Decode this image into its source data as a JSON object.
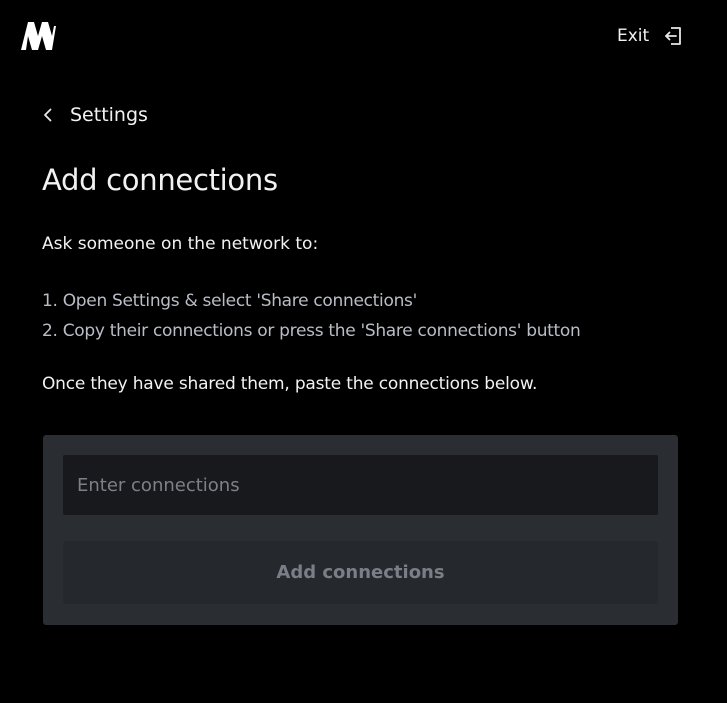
{
  "header": {
    "logo_icon": "brand-logo-icon",
    "exit_label": "Exit",
    "exit_icon": "exit-door-icon"
  },
  "nav": {
    "back_icon": "chevron-left-icon",
    "back_label": "Settings"
  },
  "main": {
    "title": "Add connections",
    "intro": "Ask someone on the network to:",
    "steps": [
      "1. Open Settings & select 'Share connections'",
      "2. Copy their connections or press the 'Share connections' button"
    ],
    "outro": "Once they have shared them, paste the connections below."
  },
  "form": {
    "input_value": "",
    "input_placeholder": "Enter connections",
    "submit_label": "Add connections",
    "submit_enabled": false
  },
  "colors": {
    "background": "#000000",
    "card": "#2a2d31",
    "input": "#18191c",
    "button_disabled": "#25282c",
    "text_primary": "#f2f2f2",
    "text_secondary": "#b9bdc6",
    "text_muted": "#7a7e86"
  }
}
